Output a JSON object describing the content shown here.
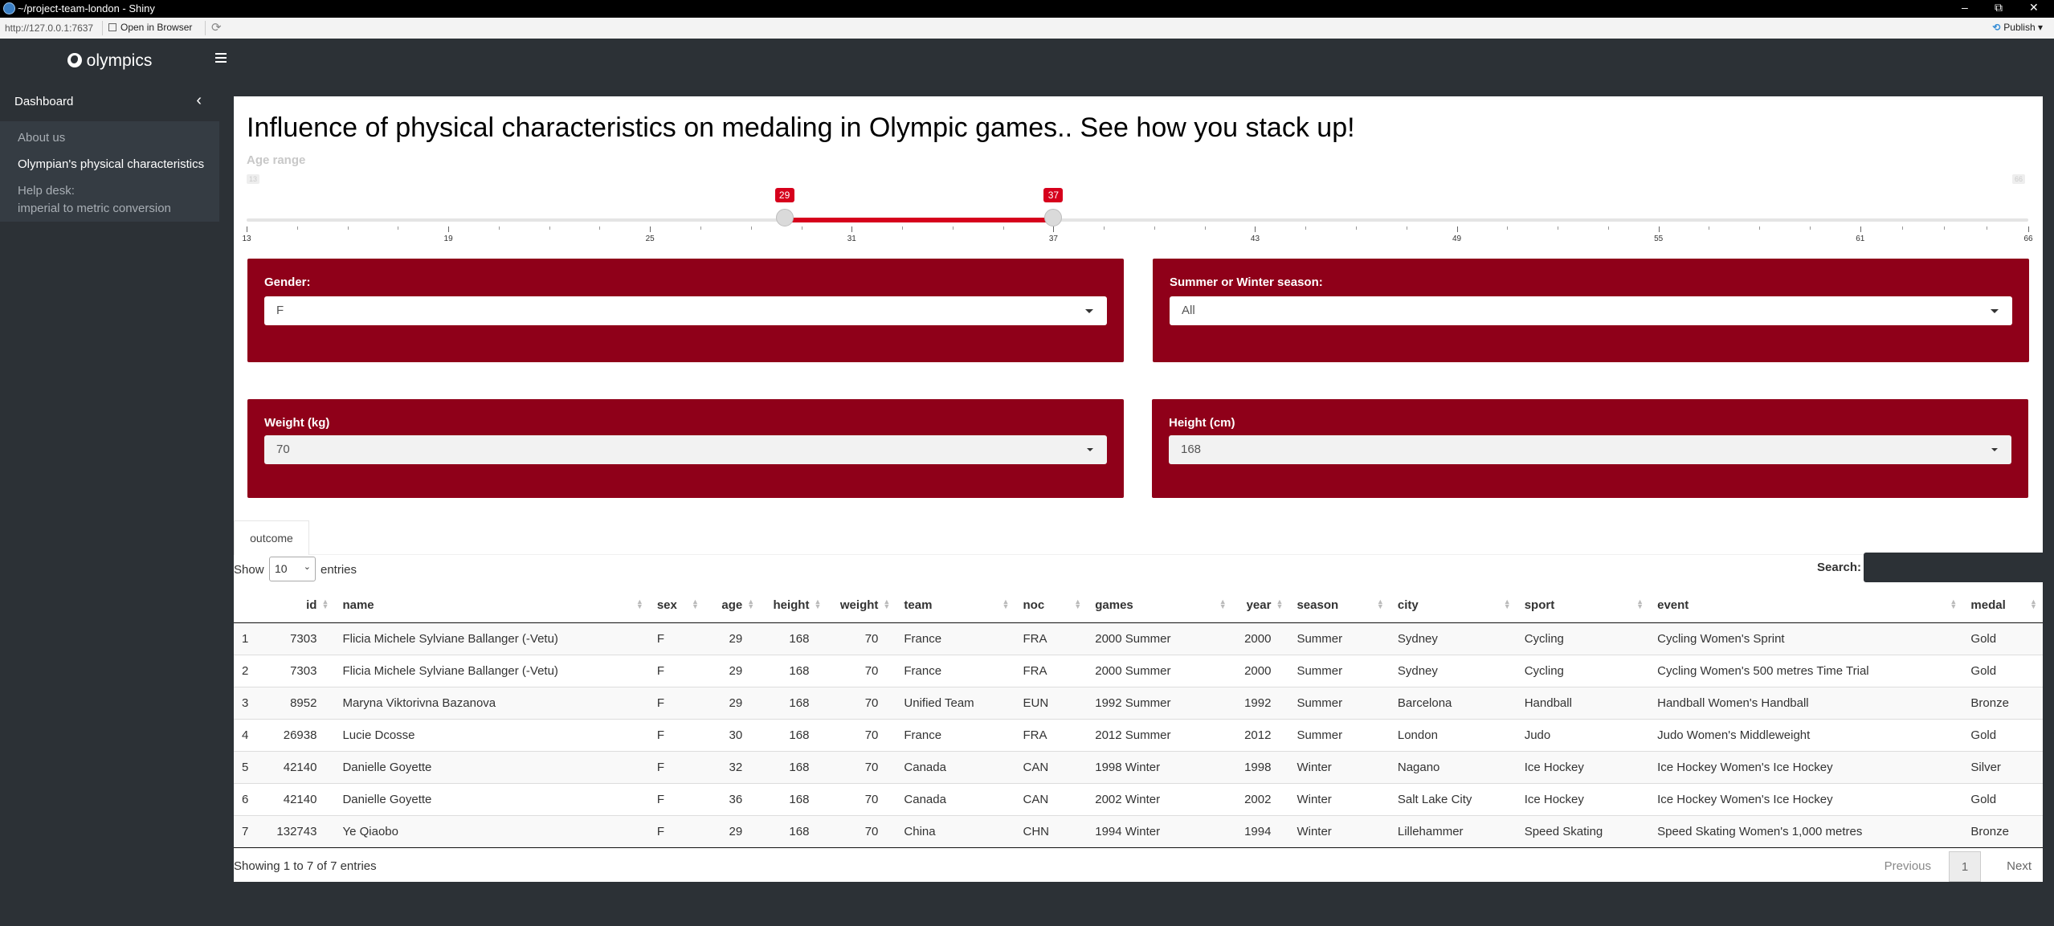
{
  "window": {
    "title": "~/project-team-london - Shiny",
    "minimize": "–",
    "maximize": "⧉",
    "close": "✕"
  },
  "addressbar": {
    "url": "http://127.0.0.1:7637",
    "open_in_browser": "Open in Browser",
    "refresh": "⟳",
    "publish": "Publish",
    "publish_icon": "⟲",
    "publish_caret": "▾"
  },
  "app": {
    "brand": "olympics",
    "brand_icon": "globe-icon"
  },
  "sidebar": {
    "dashboard": "Dashboard",
    "collapse_icon": "‹",
    "items": [
      {
        "label": "About us"
      },
      {
        "label": "Olympian's physical characteristics"
      },
      {
        "label": "Help desk:"
      },
      {
        "label": "imperial to metric conversion"
      }
    ]
  },
  "main": {
    "title": "Influence of physical characteristics on medaling in Olympic games.. See how you stack up!",
    "age_label": "Age range",
    "slider": {
      "min": 13,
      "max": 66,
      "from": 29,
      "to": 37,
      "min_label": "13",
      "max_label": "66",
      "from_label": "29",
      "to_label": "37",
      "ticks": [
        "13",
        "19",
        "25",
        "31",
        "37",
        "43",
        "49",
        "55",
        "61",
        "66"
      ],
      "accent": "#d6001c"
    },
    "filters": {
      "gender": {
        "label": "Gender:",
        "value": "F"
      },
      "season": {
        "label": "Summer or Winter season:",
        "value": "All"
      },
      "weight": {
        "label": "Weight (kg)",
        "value": "70"
      },
      "height": {
        "label": "Height (cm)",
        "value": "168"
      }
    },
    "filter_color": "#8f0019",
    "tab": "outcome",
    "show": "Show",
    "entries_value": "10",
    "entries_caret": "⌄",
    "entries": "entries",
    "search_label": "Search:"
  },
  "table": {
    "columns": [
      "",
      "id",
      "name",
      "sex",
      "age",
      "height",
      "weight",
      "team",
      "noc",
      "games",
      "year",
      "season",
      "city",
      "sport",
      "event",
      "medal"
    ],
    "rows": [
      [
        "1",
        "7303",
        "Flicia Michele Sylviane Ballanger (-Vetu)",
        "F",
        "29",
        "168",
        "70",
        "France",
        "FRA",
        "2000 Summer",
        "2000",
        "Summer",
        "Sydney",
        "Cycling",
        "Cycling Women's Sprint",
        "Gold"
      ],
      [
        "2",
        "7303",
        "Flicia Michele Sylviane Ballanger (-Vetu)",
        "F",
        "29",
        "168",
        "70",
        "France",
        "FRA",
        "2000 Summer",
        "2000",
        "Summer",
        "Sydney",
        "Cycling",
        "Cycling Women's 500 metres Time Trial",
        "Gold"
      ],
      [
        "3",
        "8952",
        "Maryna Viktorivna Bazanova",
        "F",
        "29",
        "168",
        "70",
        "Unified Team",
        "EUN",
        "1992 Summer",
        "1992",
        "Summer",
        "Barcelona",
        "Handball",
        "Handball Women's Handball",
        "Bronze"
      ],
      [
        "4",
        "26938",
        "Lucie Dcosse",
        "F",
        "30",
        "168",
        "70",
        "France",
        "FRA",
        "2012 Summer",
        "2012",
        "Summer",
        "London",
        "Judo",
        "Judo Women's Middleweight",
        "Gold"
      ],
      [
        "5",
        "42140",
        "Danielle Goyette",
        "F",
        "32",
        "168",
        "70",
        "Canada",
        "CAN",
        "1998 Winter",
        "1998",
        "Winter",
        "Nagano",
        "Ice Hockey",
        "Ice Hockey Women's Ice Hockey",
        "Silver"
      ],
      [
        "6",
        "42140",
        "Danielle Goyette",
        "F",
        "36",
        "168",
        "70",
        "Canada",
        "CAN",
        "2002 Winter",
        "2002",
        "Winter",
        "Salt Lake City",
        "Ice Hockey",
        "Ice Hockey Women's Ice Hockey",
        "Gold"
      ],
      [
        "7",
        "132743",
        "Ye Qiaobo",
        "F",
        "29",
        "168",
        "70",
        "China",
        "CHN",
        "1994 Winter",
        "1994",
        "Winter",
        "Lillehammer",
        "Speed Skating",
        "Speed Skating Women's 1,000 metres",
        "Bronze"
      ]
    ],
    "info": "Showing 1 to 7 of 7 entries",
    "previous": "Previous",
    "page": "1",
    "next": "Next"
  }
}
